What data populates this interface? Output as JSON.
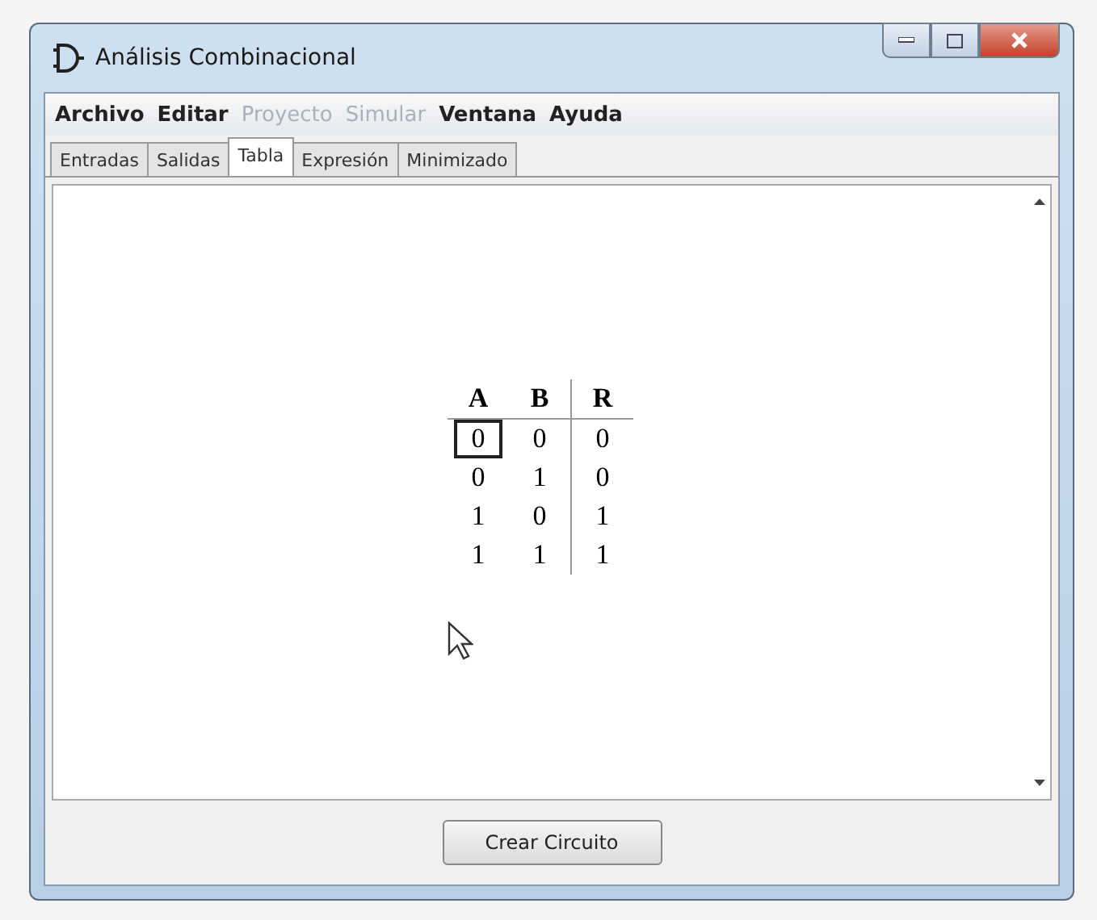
{
  "window": {
    "title": "Análisis Combinacional"
  },
  "menu": [
    {
      "label": "Archivo",
      "disabled": false
    },
    {
      "label": "Editar",
      "disabled": false
    },
    {
      "label": "Proyecto",
      "disabled": true
    },
    {
      "label": "Simular",
      "disabled": true
    },
    {
      "label": "Ventana",
      "disabled": false
    },
    {
      "label": "Ayuda",
      "disabled": false
    }
  ],
  "tabs": [
    {
      "label": "Entradas",
      "selected": false
    },
    {
      "label": "Salidas",
      "selected": false
    },
    {
      "label": "Tabla",
      "selected": true
    },
    {
      "label": "Expresión",
      "selected": false
    },
    {
      "label": "Minimizado",
      "selected": false
    }
  ],
  "table": {
    "columns": [
      {
        "label": "A",
        "kind": "input"
      },
      {
        "label": "B",
        "kind": "input"
      },
      {
        "label": "R",
        "kind": "output"
      }
    ],
    "rows": [
      {
        "cells": [
          {
            "value": "0",
            "selected": true
          },
          {
            "value": "0",
            "selected": false
          },
          {
            "value": "0",
            "selected": false
          }
        ]
      },
      {
        "cells": [
          {
            "value": "0",
            "selected": false
          },
          {
            "value": "1",
            "selected": false
          },
          {
            "value": "0",
            "selected": false
          }
        ]
      },
      {
        "cells": [
          {
            "value": "1",
            "selected": false
          },
          {
            "value": "0",
            "selected": false
          },
          {
            "value": "1",
            "selected": false
          }
        ]
      },
      {
        "cells": [
          {
            "value": "1",
            "selected": false
          },
          {
            "value": "1",
            "selected": false
          },
          {
            "value": "1",
            "selected": false
          }
        ]
      }
    ]
  },
  "button": {
    "label": "Crear Circuito"
  }
}
